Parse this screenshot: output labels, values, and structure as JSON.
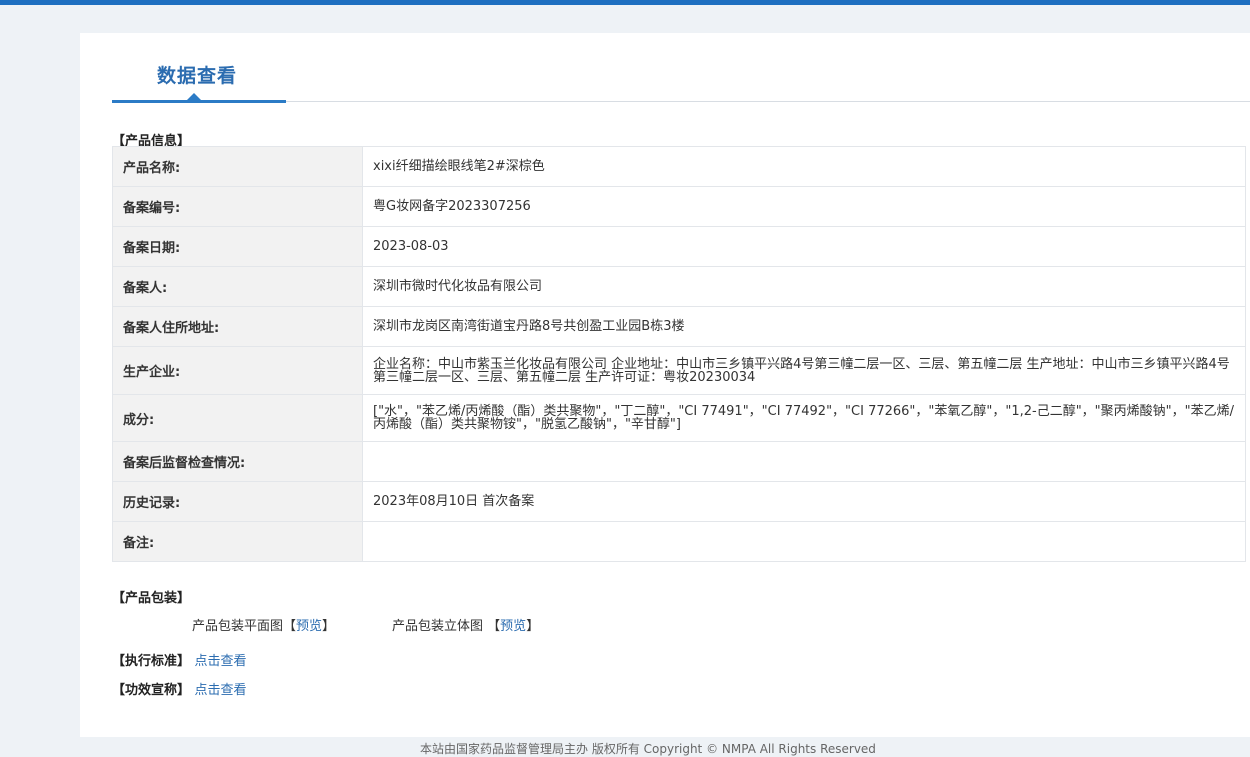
{
  "page": {
    "tab_title": "数据查看"
  },
  "sections": {
    "product_info": "【产品信息】",
    "product_package": "【产品包装】",
    "exec_standard": "【执行标准】",
    "efficacy_claim": "【功效宣称】"
  },
  "info_rows": [
    {
      "label": "产品名称:",
      "value": "xixi纤细描绘眼线笔2#深棕色"
    },
    {
      "label": "备案编号:",
      "value": "粤G妆网备字2023307256"
    },
    {
      "label": "备案日期:",
      "value": "2023-08-03"
    },
    {
      "label": "备案人:",
      "value": "深圳市微时代化妆品有限公司"
    },
    {
      "label": "备案人住所地址:",
      "value": "深圳市龙岗区南湾街道宝丹路8号共创盈工业园B栋3楼"
    },
    {
      "label": "生产企业:",
      "value": "企业名称：中山市紫玉兰化妆品有限公司 企业地址：中山市三乡镇平兴路4号第三幢二层一区、三层、第五幢二层 生产地址：中山市三乡镇平兴路4号第三幢二层一区、三层、第五幢二层 生产许可证：粤妆20230034"
    },
    {
      "label": "成分:",
      "value": "[\"水\"，\"苯乙烯/丙烯酸（酯）类共聚物\"，\"丁二醇\"，\"CI 77491\"，\"CI 77492\"，\"CI 77266\"，\"苯氧乙醇\"，\"1,2-己二醇\"，\"聚丙烯酸钠\"，\"苯乙烯/丙烯酸（酯）类共聚物铵\"，\"脱氢乙酸钠\"，\"辛甘醇\"]"
    },
    {
      "label": "备案后监督检查情况:",
      "value": ""
    },
    {
      "label": "历史记录:",
      "value": "2023年08月10日 首次备案"
    },
    {
      "label": "备注:",
      "value": ""
    }
  ],
  "package": {
    "flat_label": "产品包装平面图",
    "solid_label": "产品包装立体图",
    "bracket_open": "【",
    "bracket_close": "】",
    "preview_link": "预览"
  },
  "links": {
    "view_link": "点击查看"
  },
  "footer": {
    "text": "本站由国家药品监督管理局主办 版权所有 Copyright © NMPA All Rights Reserved"
  }
}
